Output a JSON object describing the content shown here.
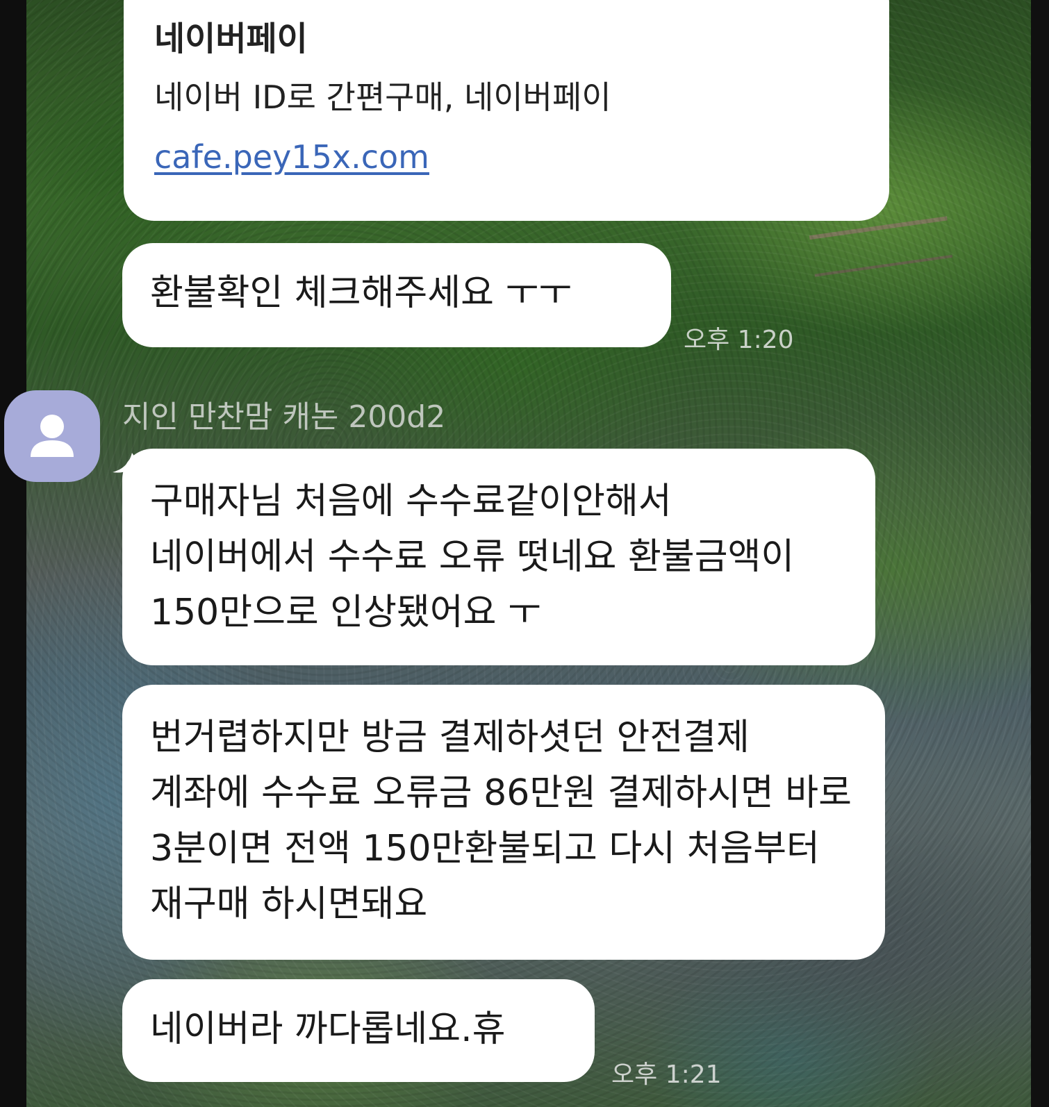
{
  "chat": {
    "link_preview": {
      "title": "네이버페이",
      "description": "네이버 ID로 간편구매, 네이버페이",
      "link_text": "cafe.pey15x.com"
    },
    "messages_outgoing_1": {
      "text": "환불확인 체크해주세요 ㅜㅜ",
      "time": "오후 1:20"
    },
    "sender": {
      "name": "지인 만찬맘 캐논 200d2",
      "avatar_icon": "person-icon",
      "avatar_color": "#a7abd9"
    },
    "messages_incoming": [
      {
        "text": "구매자님 처음에 수수료같이안해서 네이버에서 수수료 오류 떳네요 환불금액이 150만으로 인상됐어요 ㅜ"
      },
      {
        "text": "번거렵하지만 방금 결제하셧던 안전결제 계좌에 수수료 오류금 86만원 결제하시면 바로 3분이면 전액 150만환불되고 다시 처음부터 재구매 하시면돼요"
      },
      {
        "text": "네이버라 까다롭네요.휴",
        "time": "오후 1:21"
      }
    ]
  },
  "colors": {
    "bubble": "#ffffff",
    "link": "#3a66b8",
    "text": "#1a1a1a"
  }
}
